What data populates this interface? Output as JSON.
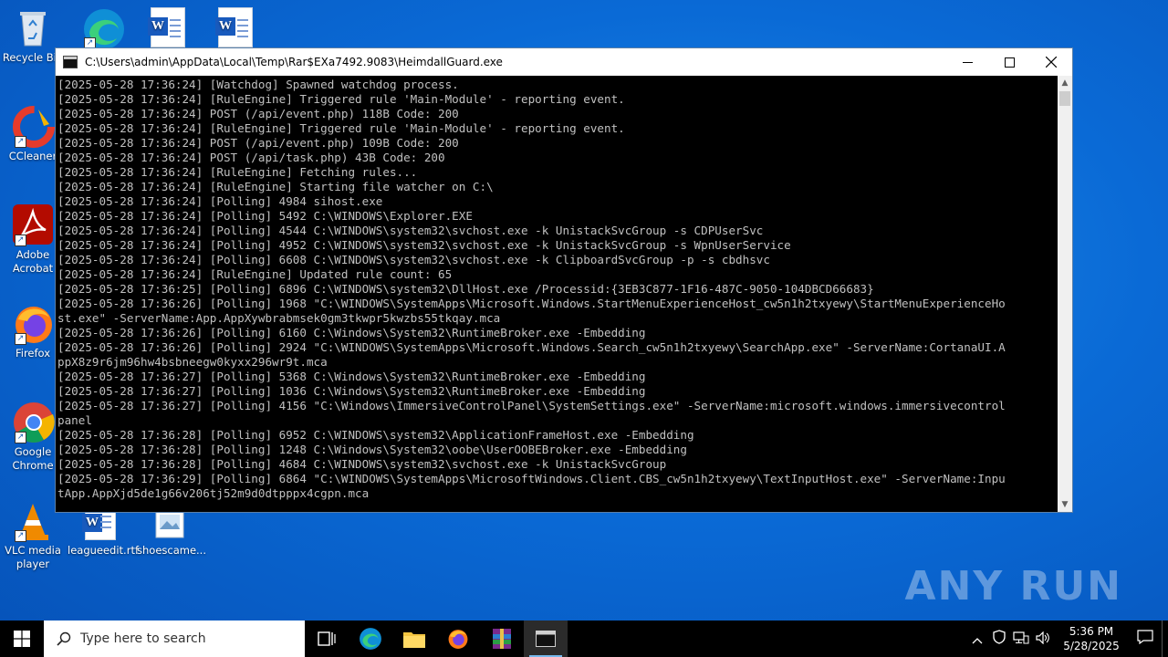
{
  "desktop": {
    "icons": [
      {
        "label": "Recycle Bin"
      },
      {
        "label": ""
      },
      {
        "label": ""
      },
      {
        "label": ""
      },
      {
        "label": "CCleaner"
      },
      {
        "label": "Adobe Acrobat"
      },
      {
        "label": "Firefox"
      },
      {
        "label": "Google Chrome"
      },
      {
        "label": "VLC media player"
      },
      {
        "label": "leagueedit.rtf"
      },
      {
        "label": "shoescame..."
      }
    ]
  },
  "window": {
    "title": "C:\\Users\\admin\\AppData\\Local\\Temp\\Rar$EXa7492.9083\\HeimdallGuard.exe",
    "console_lines": [
      "[2025-05-28 17:36:24] [Watchdog] Spawned watchdog process.",
      "[2025-05-28 17:36:24] [RuleEngine] Triggered rule 'Main-Module' - reporting event.",
      "[2025-05-28 17:36:24] POST (/api/event.php) 118B Code: 200",
      "[2025-05-28 17:36:24] [RuleEngine] Triggered rule 'Main-Module' - reporting event.",
      "[2025-05-28 17:36:24] POST (/api/event.php) 109B Code: 200",
      "[2025-05-28 17:36:24] POST (/api/task.php) 43B Code: 200",
      "[2025-05-28 17:36:24] [RuleEngine] Fetching rules...",
      "[2025-05-28 17:36:24] [RuleEngine] Starting file watcher on C:\\",
      "[2025-05-28 17:36:24] [Polling] 4984 sihost.exe",
      "[2025-05-28 17:36:24] [Polling] 5492 C:\\WINDOWS\\Explorer.EXE",
      "[2025-05-28 17:36:24] [Polling] 4544 C:\\WINDOWS\\system32\\svchost.exe -k UnistackSvcGroup -s CDPUserSvc",
      "[2025-05-28 17:36:24] [Polling] 4952 C:\\WINDOWS\\system32\\svchost.exe -k UnistackSvcGroup -s WpnUserService",
      "[2025-05-28 17:36:24] [Polling] 6608 C:\\WINDOWS\\system32\\svchost.exe -k ClipboardSvcGroup -p -s cbdhsvc",
      "[2025-05-28 17:36:24] [RuleEngine] Updated rule count: 65",
      "[2025-05-28 17:36:25] [Polling] 6896 C:\\WINDOWS\\system32\\DllHost.exe /Processid:{3EB3C877-1F16-487C-9050-104DBCD66683}",
      "[2025-05-28 17:36:26] [Polling] 1968 \"C:\\WINDOWS\\SystemApps\\Microsoft.Windows.StartMenuExperienceHost_cw5n1h2txyewy\\StartMenuExperienceHo",
      "st.exe\" -ServerName:App.AppXywbrabmsek0gm3tkwpr5kwzbs55tkqay.mca",
      "[2025-05-28 17:36:26] [Polling] 6160 C:\\Windows\\System32\\RuntimeBroker.exe -Embedding",
      "[2025-05-28 17:36:26] [Polling] 2924 \"C:\\WINDOWS\\SystemApps\\Microsoft.Windows.Search_cw5n1h2txyewy\\SearchApp.exe\" -ServerName:CortanaUI.A",
      "ppX8z9r6jm96hw4bsbneegw0kyxx296wr9t.mca",
      "[2025-05-28 17:36:27] [Polling] 5368 C:\\Windows\\System32\\RuntimeBroker.exe -Embedding",
      "[2025-05-28 17:36:27] [Polling] 1036 C:\\Windows\\System32\\RuntimeBroker.exe -Embedding",
      "[2025-05-28 17:36:27] [Polling] 4156 \"C:\\Windows\\ImmersiveControlPanel\\SystemSettings.exe\" -ServerName:microsoft.windows.immersivecontrol",
      "panel",
      "[2025-05-28 17:36:28] [Polling] 6952 C:\\WINDOWS\\system32\\ApplicationFrameHost.exe -Embedding",
      "[2025-05-28 17:36:28] [Polling] 1248 C:\\Windows\\System32\\oobe\\UserOOBEBroker.exe -Embedding",
      "[2025-05-28 17:36:28] [Polling] 4684 C:\\WINDOWS\\system32\\svchost.exe -k UnistackSvcGroup",
      "[2025-05-28 17:36:29] [Polling] 6864 \"C:\\WINDOWS\\SystemApps\\MicrosoftWindows.Client.CBS_cw5n1h2txyewy\\TextInputHost.exe\" -ServerName:Inpu",
      "tApp.AppXjd5de1g66v206tj52m9d0dtpppx4cgpn.mca"
    ]
  },
  "watermark": "ANY RUN",
  "taskbar": {
    "search_placeholder": "Type here to search",
    "time": "5:36 PM",
    "date": "5/28/2025"
  }
}
